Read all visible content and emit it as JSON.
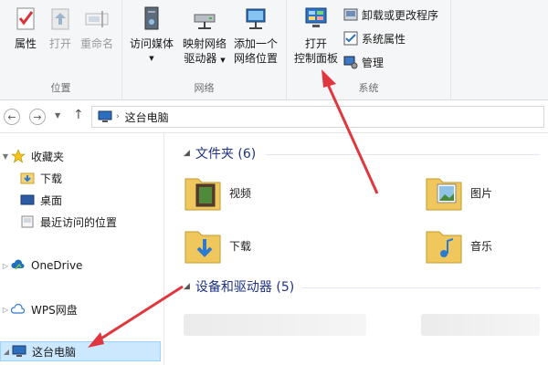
{
  "ribbon": {
    "location_group": {
      "label": "位置",
      "properties": "属性",
      "open": "打开",
      "rename": "重命名"
    },
    "network_group": {
      "label": "网络",
      "access_media": "访问媒体",
      "map_drive_1": "映射网络",
      "map_drive_2": "驱动器",
      "add_location_1": "添加一个",
      "add_location_2": "网络位置"
    },
    "system_group": {
      "label": "系统",
      "control_panel_1": "打开",
      "control_panel_2": "控制面板",
      "uninstall": "卸载或更改程序",
      "system_props": "系统属性",
      "manage": "管理"
    }
  },
  "address": {
    "path": "这台电脑"
  },
  "nav": {
    "favorites": "收藏夹",
    "downloads": "下载",
    "desktop": "桌面",
    "recent": "最近访问的位置",
    "onedrive": "OneDrive",
    "wps": "WPS网盘",
    "thispc": "这台电脑"
  },
  "content": {
    "folders_header": "文件夹 (6)",
    "devices_header": "设备和驱动器 (5)",
    "folders": {
      "videos": "视频",
      "pictures": "图片",
      "downloads": "下载",
      "music": "音乐"
    }
  },
  "colors": {
    "annotation_arrow": "#e0373f",
    "selection_bg": "#cce8ff",
    "header_blue": "#1e3287"
  }
}
